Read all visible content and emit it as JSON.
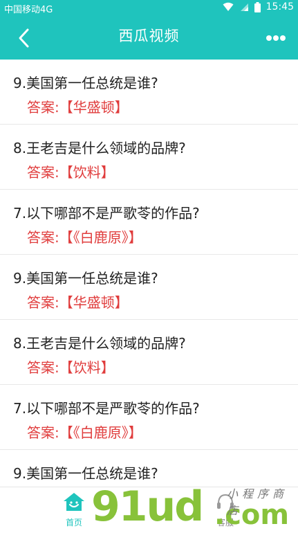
{
  "status_bar": {
    "carrier": "中国移动4G",
    "time": "15:45"
  },
  "app_bar": {
    "title": "西瓜视频",
    "back_icon": "chevron-left-icon",
    "more_icon": "more-dots-icon"
  },
  "qa_items": [
    {
      "question": "9.美国第一任总统是谁?",
      "answer": "答案:【华盛顿】"
    },
    {
      "question": "8.王老吉是什么领域的品牌?",
      "answer": "答案:【饮料】"
    },
    {
      "question": "7.以下哪部不是严歌苓的作品?",
      "answer": "答案:【《白鹿原》】"
    },
    {
      "question": "9.美国第一任总统是谁?",
      "answer": "答案:【华盛顿】"
    },
    {
      "question": "8.王老吉是什么领域的品牌?",
      "answer": "答案:【饮料】"
    },
    {
      "question": "7.以下哪部不是严歌苓的作品?",
      "answer": "答案:【《白鹿原》】"
    },
    {
      "question": "9.美国第一任总统是谁?",
      "answer": ""
    }
  ],
  "bottom_nav": {
    "home_label": "首页",
    "service_label": "客服"
  },
  "watermark": {
    "brand": "91ud",
    "domain": ".com",
    "shop": "小程序商店"
  },
  "colors": {
    "accent": "#1fc4bd",
    "answer": "#e03c3c",
    "watermark": "#88c23a"
  }
}
